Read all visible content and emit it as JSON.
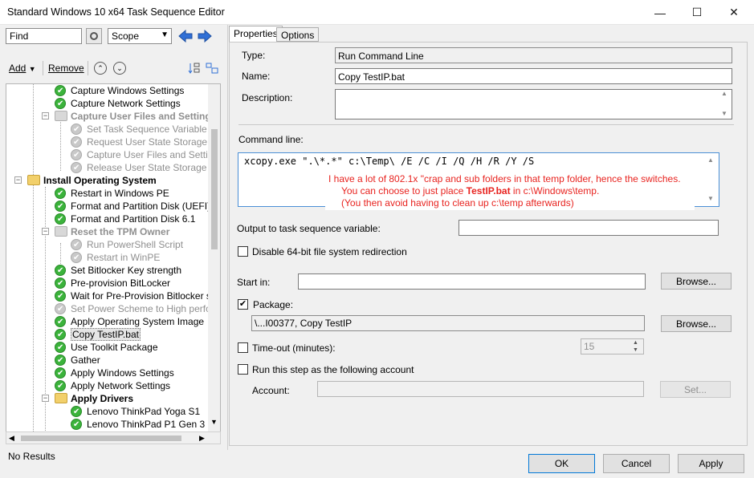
{
  "window": {
    "title": "Standard Windows 10 x64 Task Sequence Editor",
    "minimize": "—",
    "maximize": "☐",
    "close": "✕"
  },
  "search": {
    "value": "Find",
    "scope_value": "Scope"
  },
  "toolbar": {
    "add_label": "Add",
    "remove_label": "Remove"
  },
  "tree": {
    "items": [
      {
        "label": "Capture Windows Settings",
        "state": "ok"
      },
      {
        "label": "Capture Network Settings",
        "state": "ok"
      },
      {
        "label": "Capture User Files and Settings",
        "state": "group-disabled"
      },
      {
        "label": "Set Task Sequence Variable",
        "state": "disabled"
      },
      {
        "label": "Request User State Storage",
        "state": "disabled"
      },
      {
        "label": "Capture User Files and Settings",
        "state": "disabled"
      },
      {
        "label": "Release User State Storage",
        "state": "disabled"
      },
      {
        "label": "Install Operating System",
        "state": "group"
      },
      {
        "label": "Restart in Windows PE",
        "state": "ok"
      },
      {
        "label": "Format and Partition Disk (UEFI)",
        "state": "ok"
      },
      {
        "label": "Format and Partition Disk 6.1",
        "state": "ok"
      },
      {
        "label": "Reset the TPM Owner",
        "state": "group-disabled"
      },
      {
        "label": "Run PowerShell Script",
        "state": "disabled"
      },
      {
        "label": "Restart in WinPE",
        "state": "disabled"
      },
      {
        "label": "Set Bitlocker Key strength",
        "state": "ok"
      },
      {
        "label": "Pre-provision BitLocker",
        "state": "ok"
      },
      {
        "label": "Wait for Pre-Provision Bitlocker step",
        "state": "ok"
      },
      {
        "label": "Set Power Scheme to High performance",
        "state": "disabled"
      },
      {
        "label": "Apply Operating System Image",
        "state": "ok"
      },
      {
        "label": "Copy TestIP.bat",
        "state": "selected"
      },
      {
        "label": "Use Toolkit Package",
        "state": "ok"
      },
      {
        "label": "Gather",
        "state": "ok"
      },
      {
        "label": "Apply Windows Settings",
        "state": "ok"
      },
      {
        "label": "Apply Network Settings",
        "state": "ok"
      },
      {
        "label": "Apply Drivers",
        "state": "group"
      },
      {
        "label": "Lenovo ThinkPad Yoga S1",
        "state": "ok"
      },
      {
        "label": "Lenovo ThinkPad P1 Gen 3",
        "state": "ok"
      }
    ]
  },
  "status": {
    "text": "No Results"
  },
  "tabs": [
    {
      "label": "Properties"
    },
    {
      "label": "Options"
    }
  ],
  "properties": {
    "type_label": "Type:",
    "type_value": "Run Command Line",
    "name_label": "Name:",
    "name_value": "Copy TestIP.bat",
    "description_label": "Description:",
    "description_value": "",
    "command_label": "Command line:",
    "command_value": "xcopy.exe \".\\*.*\" c:\\Temp\\ /E /C /I /Q /H /R /Y /S",
    "note_line1": "I have a lot of 802.1x \"crap and sub folders in that temp folder, hence the switches.",
    "note_line2_a": "You can choose to just place ",
    "note_line2_b": "TestIP.bat",
    "note_line2_c": " in c:\\Windows\\temp.",
    "note_line3": "(You then avoid having to clean up c:\\temp afterwards)",
    "output_label": "Output to task sequence variable:",
    "output_value": "",
    "disable64_label": "Disable 64-bit file system redirection",
    "startin_label": "Start in:",
    "startin_value": "",
    "browse_label": "Browse...",
    "package_label": "Package:",
    "package_value": "\\...I00377, Copy TestIP",
    "browse2_label": "Browse...",
    "timeout_label": "Time-out (minutes):",
    "timeout_value": "15",
    "runas_label": "Run this step as the following account",
    "account_label": "Account:",
    "account_value": "",
    "set_label": "Set..."
  },
  "footer": {
    "ok_label": "OK",
    "cancel_label": "Cancel",
    "apply_label": "Apply"
  }
}
